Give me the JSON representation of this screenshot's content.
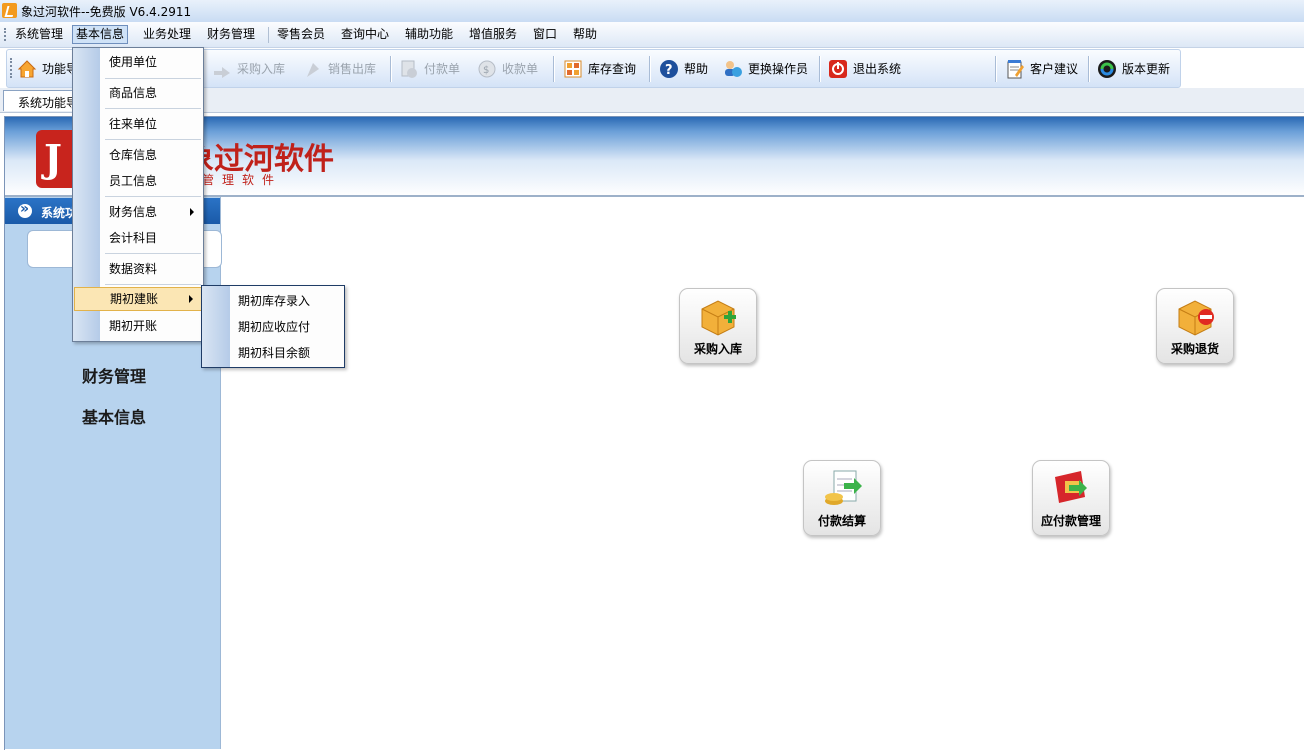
{
  "window": {
    "title": "象过河软件--免费版 V6.4.2911"
  },
  "menubar": {
    "items": [
      {
        "label": "系统管理"
      },
      {
        "label": "基本信息"
      },
      {
        "label": "业务处理"
      },
      {
        "label": "财务管理"
      },
      {
        "label": "零售会员"
      },
      {
        "label": "查询中心"
      },
      {
        "label": "辅助功能"
      },
      {
        "label": "增值服务"
      },
      {
        "label": "窗口"
      },
      {
        "label": "帮助"
      }
    ]
  },
  "toolbar": {
    "items": [
      {
        "label": "功能导航",
        "icon": "home-icon",
        "enabled": true
      },
      {
        "label": "采购入库",
        "icon": "purchase-in-icon",
        "enabled": false
      },
      {
        "label": "销售出库",
        "icon": "sales-out-icon",
        "enabled": false
      },
      {
        "label": "付款单",
        "icon": "payment-icon",
        "enabled": false
      },
      {
        "label": "收款单",
        "icon": "receipt-icon",
        "enabled": false
      },
      {
        "label": "库存查询",
        "icon": "inventory-icon",
        "enabled": true
      },
      {
        "label": "帮助",
        "icon": "help-icon",
        "enabled": true
      },
      {
        "label": "更换操作员",
        "icon": "switch-user-icon",
        "enabled": true
      },
      {
        "label": "退出系统",
        "icon": "exit-icon",
        "enabled": true
      },
      {
        "label": "客户建议",
        "icon": "suggestion-icon",
        "enabled": true
      },
      {
        "label": "版本更新",
        "icon": "update-icon",
        "enabled": true
      }
    ]
  },
  "tabs": [
    {
      "label": "系统功能导航"
    }
  ],
  "banner": {
    "logo_text": "象过河软件",
    "logo_sub": "管理软件",
    "logo_letter": "J"
  },
  "left_panel": {
    "header": "系统功能导航",
    "items": [
      {
        "label": "财务管理"
      },
      {
        "label": "基本信息"
      }
    ]
  },
  "dropdown": {
    "items": [
      {
        "label": "使用单位",
        "submenu": false
      },
      {
        "label": "商品信息",
        "submenu": false
      },
      {
        "label": "往来单位",
        "submenu": false
      },
      {
        "label": "仓库信息",
        "submenu": false
      },
      {
        "label": "员工信息",
        "submenu": false
      },
      {
        "label": "财务信息",
        "submenu": true
      },
      {
        "label": "会计科目",
        "submenu": false
      },
      {
        "label": "数据资料",
        "submenu": false
      },
      {
        "label": "期初建账",
        "submenu": true
      },
      {
        "label": "期初开账",
        "submenu": false
      }
    ]
  },
  "submenu": {
    "items": [
      {
        "label": "期初库存录入"
      },
      {
        "label": "期初应收应付"
      },
      {
        "label": "期初科目余额"
      }
    ]
  },
  "desktop": {
    "buttons": [
      {
        "label": "采购入库",
        "icon": "purchase-in-box-icon"
      },
      {
        "label": "采购退货",
        "icon": "purchase-return-box-icon"
      },
      {
        "label": "付款结算",
        "icon": "payment-settlement-icon"
      },
      {
        "label": "应付款管理",
        "icon": "payable-management-icon"
      }
    ]
  },
  "colors": {
    "brand_red": "#c0211a",
    "accent_blue": "#1a5aa8",
    "menu_highlight": "#fbe6b4"
  }
}
